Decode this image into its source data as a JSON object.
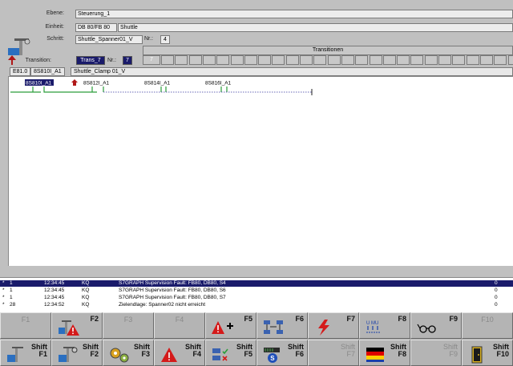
{
  "header": {
    "ebene_label": "Ebene:",
    "ebene_value": "Steuerung_1",
    "einheit_label": "Einheit:",
    "einheit_value": "DB 80/FB 80",
    "einheit_value2": "Shuttle",
    "schritt_label": "Schritt:",
    "schritt_value": "Shuttle_Spanner01_V",
    "nr_label": "Nr.:",
    "nr_value": "4",
    "transition_label": "Transition:",
    "transition_value": "Trans_7",
    "trans_nr_label": "Nr.:",
    "trans_nr_value": "7",
    "transitionen_label": "Transitionen",
    "transitionen_first": "7"
  },
  "crumbs": [
    "E81.0",
    "8S810I_A1",
    "Shuttle_Clamp 01_V"
  ],
  "graph": {
    "operands": [
      "8S810I_A1",
      "8S812I_A1",
      "8S814I_A1",
      "8S816I_A1"
    ]
  },
  "alarms": [
    {
      "marker": "*",
      "num": "1",
      "time": "12:34:45",
      "code": "KQ",
      "text": "S7GRAPH Supervision Fault: FB80, DB80, S4",
      "count": "0",
      "selected": true
    },
    {
      "marker": "*",
      "num": "1",
      "time": "12:34:45",
      "code": "KQ",
      "text": "S7GRAPH Supervision Fault: FB80, DB80, S6",
      "count": "0",
      "selected": false
    },
    {
      "marker": "*",
      "num": "1",
      "time": "12:34:45",
      "code": "KQ",
      "text": "S7GRAPH Supervision Fault: FB80, DB80, S7",
      "count": "0",
      "selected": false
    },
    {
      "marker": "*",
      "num": "28",
      "time": "12:34:52",
      "code": "KQ",
      "text": "Zielendlage: Spanner02  nicht erreicht",
      "count": "0",
      "selected": false
    }
  ],
  "fkeys_top": [
    {
      "label": "F1",
      "active": false,
      "icon": ""
    },
    {
      "label": "F2",
      "active": true,
      "icon": "manual-operation-warning-icon"
    },
    {
      "label": "F3",
      "active": false,
      "icon": ""
    },
    {
      "label": "F4",
      "active": false,
      "icon": ""
    },
    {
      "label": "F5",
      "active": true,
      "icon": "add-alarm-icon"
    },
    {
      "label": "F6",
      "active": true,
      "icon": "network-overview-icon"
    },
    {
      "label": "F7",
      "active": true,
      "icon": "lightning-icon"
    },
    {
      "label": "F8",
      "active": true,
      "icon": "signal-status-icon"
    },
    {
      "label": "F9",
      "active": true,
      "icon": "glasses-icon"
    },
    {
      "label": "F10",
      "active": false,
      "icon": ""
    }
  ],
  "fkeys_bottom": [
    {
      "shift": "Shift",
      "label": "F1",
      "active": true,
      "icon": "machine-icon"
    },
    {
      "shift": "Shift",
      "label": "F2",
      "active": true,
      "icon": "manual-operation-icon"
    },
    {
      "shift": "Shift",
      "label": "F3",
      "active": true,
      "icon": "gears-icon"
    },
    {
      "shift": "Shift",
      "label": "F4",
      "active": true,
      "icon": "warning-icon"
    },
    {
      "shift": "Shift",
      "label": "F5",
      "active": true,
      "icon": "checklist-icon"
    },
    {
      "shift": "Shift",
      "label": "F6",
      "active": true,
      "icon": "s-device-icon"
    },
    {
      "shift": "Shift",
      "label": "F7",
      "active": false,
      "icon": ""
    },
    {
      "shift": "Shift",
      "label": "F8",
      "active": true,
      "icon": "language-flags-icon"
    },
    {
      "shift": "Shift",
      "label": "F9",
      "active": false,
      "icon": ""
    },
    {
      "shift": "Shift",
      "label": "F10",
      "active": true,
      "icon": "exit-door-icon"
    }
  ],
  "colors": {
    "selected_row": "#1a1b6b",
    "graph_green": "#2a9d3a",
    "warning_red": "#d41a1a"
  }
}
